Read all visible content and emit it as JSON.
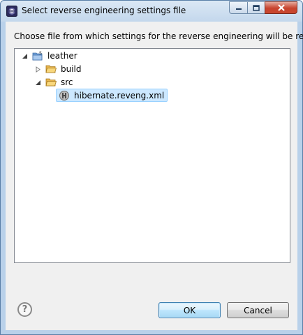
{
  "window": {
    "title": "Select reverse engineering settings file",
    "icon": "eclipse-icon"
  },
  "dialog": {
    "message": "Choose file from which settings for the reverse engineering will be read"
  },
  "tree": {
    "nodes": [
      {
        "label": "leather",
        "icon": "project-folder-icon",
        "expanded": true
      },
      {
        "label": "build",
        "icon": "folder-icon",
        "expanded": false
      },
      {
        "label": "src",
        "icon": "folder-icon",
        "expanded": true
      },
      {
        "label": "hibernate.reveng.xml",
        "icon": "hibernate-file-icon",
        "selected": true
      }
    ]
  },
  "buttons": {
    "help": "?",
    "ok": "OK",
    "cancel": "Cancel"
  },
  "colors": {
    "selection_bg": "#cce8ff",
    "selection_border": "#99d1ff",
    "ok_border": "#3c7fb1"
  }
}
